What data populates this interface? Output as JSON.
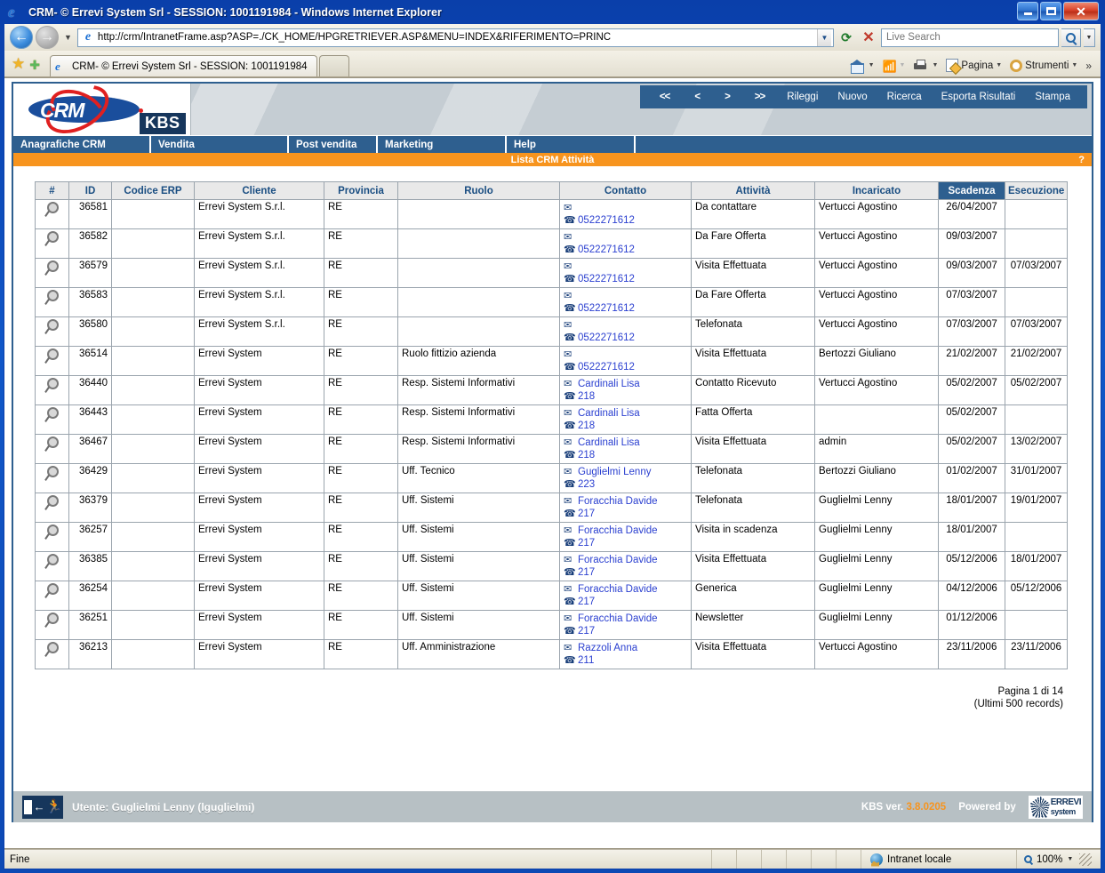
{
  "browser": {
    "window_title": "CRM- © Errevi System Srl - SESSION: 1001191984 - Windows Internet Explorer",
    "url": "http://crm/IntranetFrame.asp?ASP=./CK_HOME/HPGRETRIEVER.ASP&MENU=INDEX&RIFERIMENTO=PRINC",
    "search_placeholder": "Live Search",
    "tab_label": "CRM- © Errevi System Srl - SESSION: 1001191984",
    "commands": {
      "page": "Pagina",
      "tools": "Strumenti",
      "overflow": "»"
    },
    "status": {
      "text": "Fine",
      "zone": "Intranet locale",
      "zoom": "100%"
    }
  },
  "app": {
    "logo_text": "CRM",
    "logo_badge": "KBS",
    "toolbar": [
      {
        "label": "<<",
        "name": "first-page-button",
        "type": "arrow"
      },
      {
        "label": "<",
        "name": "prev-page-button",
        "type": "arrow"
      },
      {
        "label": ">",
        "name": "next-page-button",
        "type": "arrow"
      },
      {
        "label": ">>",
        "name": "last-page-button",
        "type": "arrow"
      },
      {
        "label": "Rileggi",
        "name": "reload-button",
        "type": "text"
      },
      {
        "label": "Nuovo",
        "name": "new-button",
        "type": "text"
      },
      {
        "label": "Ricerca",
        "name": "search-button",
        "type": "text"
      },
      {
        "label": "Esporta Risultati",
        "name": "export-results-button",
        "type": "text"
      },
      {
        "label": "Stampa",
        "name": "print-button",
        "type": "text"
      }
    ],
    "menu": [
      {
        "label": "Anagrafiche CRM",
        "name": "menu-anagrafiche-crm"
      },
      {
        "label": "Vendita",
        "name": "menu-vendita"
      },
      {
        "label": "Post vendita",
        "name": "menu-post-vendita"
      },
      {
        "label": "Marketing",
        "name": "menu-marketing"
      },
      {
        "label": "Help",
        "name": "menu-help"
      }
    ],
    "page_title": "Lista CRM Attività",
    "help_marker": "?",
    "pagination": {
      "page_info": "Pagina 1 di 14",
      "records_info": "(Ultimi 500 records)"
    },
    "footer": {
      "user": "Utente: Guglielmi Lenny (lguglielmi)",
      "version_label": "KBS ver.",
      "version_number": "3.8.0205",
      "powered_by": "Powered by",
      "vendor_line1": "ERREVI",
      "vendor_line2": "system"
    },
    "colors": {
      "accent_blue": "#2e5f8f",
      "accent_orange": "#f7941e",
      "link_blue": "#2a3fd0"
    }
  },
  "table": {
    "columns": [
      {
        "key": "num",
        "label": "#",
        "sorted": false
      },
      {
        "key": "id",
        "label": "ID",
        "sorted": false
      },
      {
        "key": "erp",
        "label": "Codice ERP",
        "sorted": false
      },
      {
        "key": "cliente",
        "label": "Cliente",
        "sorted": false
      },
      {
        "key": "provincia",
        "label": "Provincia",
        "sorted": false
      },
      {
        "key": "ruolo",
        "label": "Ruolo",
        "sorted": false
      },
      {
        "key": "contatto",
        "label": "Contatto",
        "sorted": false
      },
      {
        "key": "attivita",
        "label": "Attività",
        "sorted": false
      },
      {
        "key": "incaricato",
        "label": "Incaricato",
        "sorted": false
      },
      {
        "key": "scadenza",
        "label": "Scadenza",
        "sorted": true
      },
      {
        "key": "esecuzione",
        "label": "Esecuzione",
        "sorted": false
      }
    ],
    "rows": [
      {
        "id": "36581",
        "erp": "",
        "cliente": "Errevi System S.r.l.",
        "provincia": "RE",
        "ruolo": "",
        "contact_name": "",
        "contact_phone": "0522271612",
        "attivita": "Da contattare",
        "incaricato": "Vertucci Agostino",
        "scadenza": "26/04/2007",
        "esecuzione": ""
      },
      {
        "id": "36582",
        "erp": "",
        "cliente": "Errevi System S.r.l.",
        "provincia": "RE",
        "ruolo": "",
        "contact_name": "",
        "contact_phone": "0522271612",
        "attivita": "Da Fare Offerta",
        "incaricato": "Vertucci Agostino",
        "scadenza": "09/03/2007",
        "esecuzione": ""
      },
      {
        "id": "36579",
        "erp": "",
        "cliente": "Errevi System S.r.l.",
        "provincia": "RE",
        "ruolo": "",
        "contact_name": "",
        "contact_phone": "0522271612",
        "attivita": "Visita Effettuata",
        "incaricato": "Vertucci Agostino",
        "scadenza": "09/03/2007",
        "esecuzione": "07/03/2007"
      },
      {
        "id": "36583",
        "erp": "",
        "cliente": "Errevi System S.r.l.",
        "provincia": "RE",
        "ruolo": "",
        "contact_name": "",
        "contact_phone": "0522271612",
        "attivita": "Da Fare Offerta",
        "incaricato": "Vertucci Agostino",
        "scadenza": "07/03/2007",
        "esecuzione": ""
      },
      {
        "id": "36580",
        "erp": "",
        "cliente": "Errevi System S.r.l.",
        "provincia": "RE",
        "ruolo": "",
        "contact_name": "",
        "contact_phone": "0522271612",
        "attivita": "Telefonata",
        "incaricato": "Vertucci Agostino",
        "scadenza": "07/03/2007",
        "esecuzione": "07/03/2007"
      },
      {
        "id": "36514",
        "erp": "",
        "cliente": "Errevi System",
        "provincia": "RE",
        "ruolo": "Ruolo fittizio azienda",
        "contact_name": "",
        "contact_phone": "0522271612",
        "attivita": "Visita Effettuata",
        "incaricato": "Bertozzi Giuliano",
        "scadenza": "21/02/2007",
        "esecuzione": "21/02/2007"
      },
      {
        "id": "36440",
        "erp": "",
        "cliente": "Errevi System",
        "provincia": "RE",
        "ruolo": "Resp. Sistemi Informativi",
        "contact_name": "Cardinali Lisa",
        "contact_phone": "218",
        "attivita": "Contatto Ricevuto",
        "incaricato": "Vertucci Agostino",
        "scadenza": "05/02/2007",
        "esecuzione": "05/02/2007"
      },
      {
        "id": "36443",
        "erp": "",
        "cliente": "Errevi System",
        "provincia": "RE",
        "ruolo": "Resp. Sistemi Informativi",
        "contact_name": "Cardinali Lisa",
        "contact_phone": "218",
        "attivita": "Fatta Offerta",
        "incaricato": "",
        "scadenza": "05/02/2007",
        "esecuzione": ""
      },
      {
        "id": "36467",
        "erp": "",
        "cliente": "Errevi System",
        "provincia": "RE",
        "ruolo": "Resp. Sistemi Informativi",
        "contact_name": "Cardinali Lisa",
        "contact_phone": "218",
        "attivita": "Visita Effettuata",
        "incaricato": "admin",
        "scadenza": "05/02/2007",
        "esecuzione": "13/02/2007"
      },
      {
        "id": "36429",
        "erp": "",
        "cliente": "Errevi System",
        "provincia": "RE",
        "ruolo": "Uff. Tecnico",
        "contact_name": "Guglielmi Lenny",
        "contact_phone": "223",
        "attivita": "Telefonata",
        "incaricato": "Bertozzi Giuliano",
        "scadenza": "01/02/2007",
        "esecuzione": "31/01/2007"
      },
      {
        "id": "36379",
        "erp": "",
        "cliente": "Errevi System",
        "provincia": "RE",
        "ruolo": "Uff. Sistemi",
        "contact_name": "Foracchia Davide",
        "contact_phone": "217",
        "attivita": "Telefonata",
        "incaricato": "Guglielmi Lenny",
        "scadenza": "18/01/2007",
        "esecuzione": "19/01/2007"
      },
      {
        "id": "36257",
        "erp": "",
        "cliente": "Errevi System",
        "provincia": "RE",
        "ruolo": "Uff. Sistemi",
        "contact_name": "Foracchia Davide",
        "contact_phone": "217",
        "attivita": "Visita in scadenza",
        "incaricato": "Guglielmi Lenny",
        "scadenza": "18/01/2007",
        "esecuzione": ""
      },
      {
        "id": "36385",
        "erp": "",
        "cliente": "Errevi System",
        "provincia": "RE",
        "ruolo": "Uff. Sistemi",
        "contact_name": "Foracchia Davide",
        "contact_phone": "217",
        "attivita": "Visita Effettuata",
        "incaricato": "Guglielmi Lenny",
        "scadenza": "05/12/2006",
        "esecuzione": "18/01/2007"
      },
      {
        "id": "36254",
        "erp": "",
        "cliente": "Errevi System",
        "provincia": "RE",
        "ruolo": "Uff. Sistemi",
        "contact_name": "Foracchia Davide",
        "contact_phone": "217",
        "attivita": "Generica",
        "incaricato": "Guglielmi Lenny",
        "scadenza": "04/12/2006",
        "esecuzione": "05/12/2006"
      },
      {
        "id": "36251",
        "erp": "",
        "cliente": "Errevi System",
        "provincia": "RE",
        "ruolo": "Uff. Sistemi",
        "contact_name": "Foracchia Davide",
        "contact_phone": "217",
        "attivita": "Newsletter",
        "incaricato": "Guglielmi Lenny",
        "scadenza": "01/12/2006",
        "esecuzione": ""
      },
      {
        "id": "36213",
        "erp": "",
        "cliente": "Errevi System",
        "provincia": "RE",
        "ruolo": "Uff. Amministrazione",
        "contact_name": "Razzoli Anna",
        "contact_phone": "211",
        "attivita": "Visita Effettuata",
        "incaricato": "Vertucci Agostino",
        "scadenza": "23/11/2006",
        "esecuzione": "23/11/2006"
      }
    ]
  }
}
